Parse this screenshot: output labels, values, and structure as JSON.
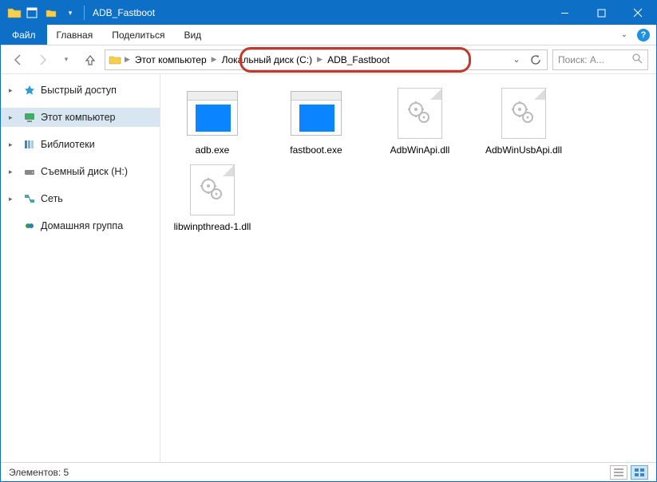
{
  "titlebar": {
    "title": "ADB_Fastboot"
  },
  "ribbon": {
    "file": "Файл",
    "tabs": [
      "Главная",
      "Поделиться",
      "Вид"
    ]
  },
  "breadcrumbs": {
    "root": "Этот компьютер",
    "drive": "Локальный диск (C:)",
    "folder": "ADB_Fastboot"
  },
  "search": {
    "placeholder": "Поиск: A..."
  },
  "nav": {
    "quick_access": "Быстрый доступ",
    "this_pc": "Этот компьютер",
    "libraries": "Библиотеки",
    "removable": "Съемный диск (H:)",
    "network": "Сеть",
    "homegroup": "Домашняя группа"
  },
  "files": [
    {
      "name": "adb.exe",
      "type": "exe"
    },
    {
      "name": "fastboot.exe",
      "type": "exe"
    },
    {
      "name": "AdbWinApi.dll",
      "type": "dll"
    },
    {
      "name": "AdbWinUsbApi.dll",
      "type": "dll"
    },
    {
      "name": "libwinpthread-1.dll",
      "type": "dll"
    }
  ],
  "statusbar": {
    "count_label": "Элементов: 5"
  }
}
